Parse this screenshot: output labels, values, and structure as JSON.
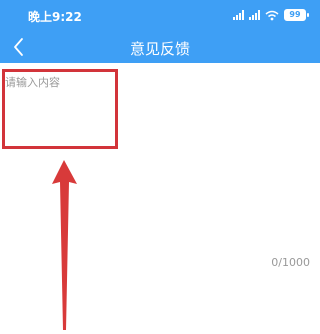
{
  "statusbar": {
    "time": "晚上9:22",
    "battery": "99"
  },
  "navbar": {
    "title": "意见反馈",
    "back_icon": "chevron-left-icon"
  },
  "form": {
    "placeholder": "请输入内容",
    "counter": "0/1000"
  },
  "colors": {
    "header": "#3e9ff5",
    "highlight": "#d2343a",
    "arrow": "#d83a3a"
  }
}
